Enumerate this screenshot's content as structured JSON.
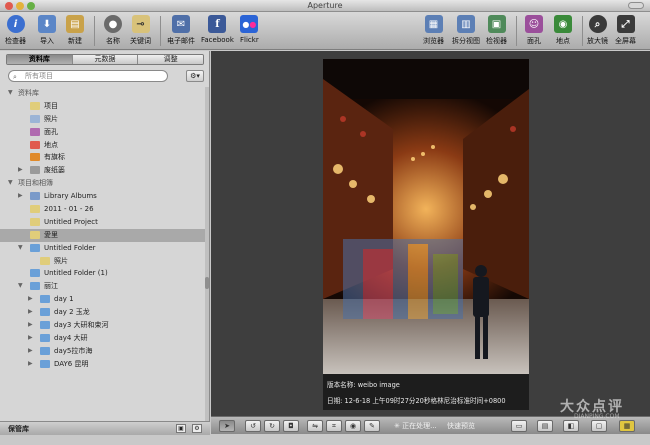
{
  "window": {
    "title": "Aperture"
  },
  "toolbar": {
    "buttons": [
      {
        "label": "检查器",
        "icon": "info-icon",
        "color": "#3b6fd0"
      },
      {
        "label": "导入",
        "icon": "import-arrow-icon",
        "color": "#5b86c7"
      },
      {
        "label": "新建",
        "icon": "new-project-icon",
        "color": "#c9a24a"
      },
      {
        "label": "名称",
        "icon": "person-name-icon",
        "color": "#6a6a6a"
      },
      {
        "label": "关键词",
        "icon": "keyword-tag-icon",
        "color": "#d8c27a"
      },
      {
        "label": "电子邮件",
        "icon": "email-icon",
        "color": "#4f6fa8"
      },
      {
        "label": "Facebook",
        "icon": "facebook-icon",
        "color": "#3b5998"
      },
      {
        "label": "Flickr",
        "icon": "flickr-icon",
        "color": "#2b64d6"
      },
      {
        "label": "浏览器",
        "icon": "browser-grid-icon",
        "color": "#5c7fb5"
      },
      {
        "label": "拆分视图",
        "icon": "split-view-icon",
        "color": "#5c7fb5"
      },
      {
        "label": "检视器",
        "icon": "viewer-icon",
        "color": "#4f8a5a"
      },
      {
        "label": "面孔",
        "icon": "faces-icon",
        "color": "#9b4f9b"
      },
      {
        "label": "地点",
        "icon": "places-icon",
        "color": "#3a8a3a"
      },
      {
        "label": "放大镜",
        "icon": "loupe-icon",
        "color": "#3a3a3a"
      },
      {
        "label": "全屏幕",
        "icon": "fullscreen-icon",
        "color": "#3a3a3a"
      }
    ]
  },
  "sidebar": {
    "tabs": [
      "资料库",
      "元数据",
      "调整"
    ],
    "search_placeholder": "所有项目",
    "items": [
      {
        "label": "资料库",
        "type": "header",
        "indent": 0,
        "tri": "▼"
      },
      {
        "label": "项目",
        "type": "item",
        "indent": 1,
        "color": "#e0cd7a"
      },
      {
        "label": "照片",
        "type": "item",
        "indent": 1,
        "color": "#9bb4d6"
      },
      {
        "label": "面孔",
        "type": "item",
        "indent": 1,
        "color": "#b06ab0"
      },
      {
        "label": "地点",
        "type": "item",
        "indent": 1,
        "color": "#e05a4f"
      },
      {
        "label": "有旗标",
        "type": "item",
        "indent": 1,
        "color": "#e08a2a"
      },
      {
        "label": "废纸篓",
        "type": "item",
        "indent": 1,
        "color": "#9a9a9a",
        "tri": "▶"
      },
      {
        "label": "项目和相簿",
        "type": "header",
        "indent": 0,
        "tri": "▼"
      },
      {
        "label": "Library Albums",
        "type": "item",
        "indent": 1,
        "color": "#7a9ac9",
        "tri": "▶"
      },
      {
        "label": "2011 - 01 - 26",
        "type": "item",
        "indent": 1,
        "color": "#e0cd7a"
      },
      {
        "label": "Untitled Project",
        "type": "item",
        "indent": 1,
        "color": "#e0cd7a"
      },
      {
        "label": "愛里",
        "type": "item",
        "indent": 1,
        "color": "#e0cd7a",
        "selected": true
      },
      {
        "label": "Untitled Folder",
        "type": "item",
        "indent": 1,
        "color": "#6aa0d8",
        "tri": "▼"
      },
      {
        "label": "照片",
        "type": "item",
        "indent": 2,
        "color": "#e0cd7a"
      },
      {
        "label": "Untitled Folder (1)",
        "type": "item",
        "indent": 1,
        "color": "#6aa0d8"
      },
      {
        "label": "丽江",
        "type": "item",
        "indent": 1,
        "color": "#6aa0d8",
        "tri": "▼"
      },
      {
        "label": "day 1",
        "type": "item",
        "indent": 2,
        "color": "#6aa0d8",
        "tri": "▶"
      },
      {
        "label": "day 2 玉龙",
        "type": "item",
        "indent": 2,
        "color": "#6aa0d8",
        "tri": "▶"
      },
      {
        "label": "day3 大研和束河",
        "type": "item",
        "indent": 2,
        "color": "#6aa0d8",
        "tri": "▶"
      },
      {
        "label": "day4 大研",
        "type": "item",
        "indent": 2,
        "color": "#6aa0d8",
        "tri": "▶"
      },
      {
        "label": "day5拉市海",
        "type": "item",
        "indent": 2,
        "color": "#6aa0d8",
        "tri": "▶"
      },
      {
        "label": "DAY6 昆明",
        "type": "item",
        "indent": 2,
        "color": "#6aa0d8",
        "tri": "▶"
      }
    ],
    "bottom_label": "保管库"
  },
  "viewer": {
    "meta_version": "版本名称: weibo image",
    "meta_date": "日期: 12-6-18 上午09时27分20秒格林尼治标准时间+0800",
    "processing": "正在处理...",
    "quick_preview": "快速预览"
  },
  "watermark": {
    "cn": "大众点评",
    "en": "DIANPING.COM"
  }
}
